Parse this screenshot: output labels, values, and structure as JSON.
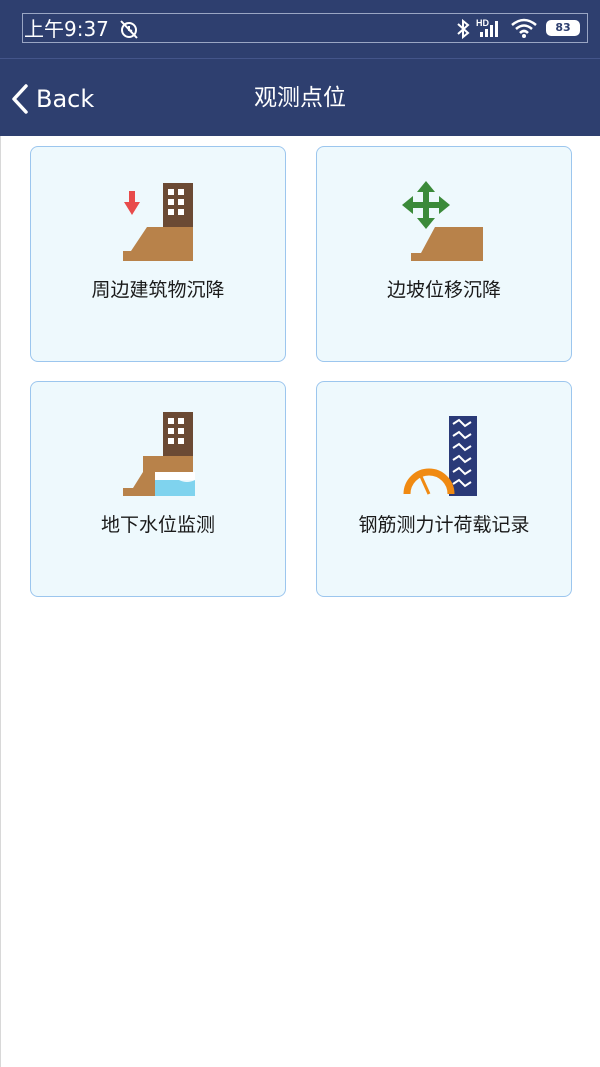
{
  "status_bar": {
    "time": "上午9:37",
    "battery": "83",
    "icons": [
      "alarm-off-icon",
      "bluetooth-icon",
      "hd-signal-icon",
      "wifi-icon",
      "battery-icon"
    ]
  },
  "nav": {
    "back_label": "Back",
    "title": "观测点位"
  },
  "cards": [
    {
      "label": "周边建筑物沉降",
      "icon": "building-settlement-icon"
    },
    {
      "label": "边坡位移沉降",
      "icon": "slope-displacement-icon"
    },
    {
      "label": "地下水位监测",
      "icon": "groundwater-level-icon"
    },
    {
      "label": "钢筋测力计荷载记录",
      "icon": "rebar-gauge-icon"
    }
  ],
  "colors": {
    "header": "#2e3f6f",
    "card_bg": "#eef9fd",
    "card_border": "#9cc6ee",
    "soil": "#b8824a",
    "building": "#6b4a34",
    "arrow_red": "#e84b4b",
    "arrow_green": "#3b8a3a",
    "water": "#7fd3ee",
    "gauge_orange": "#f08a12",
    "rebar_navy": "#2a3a78"
  }
}
